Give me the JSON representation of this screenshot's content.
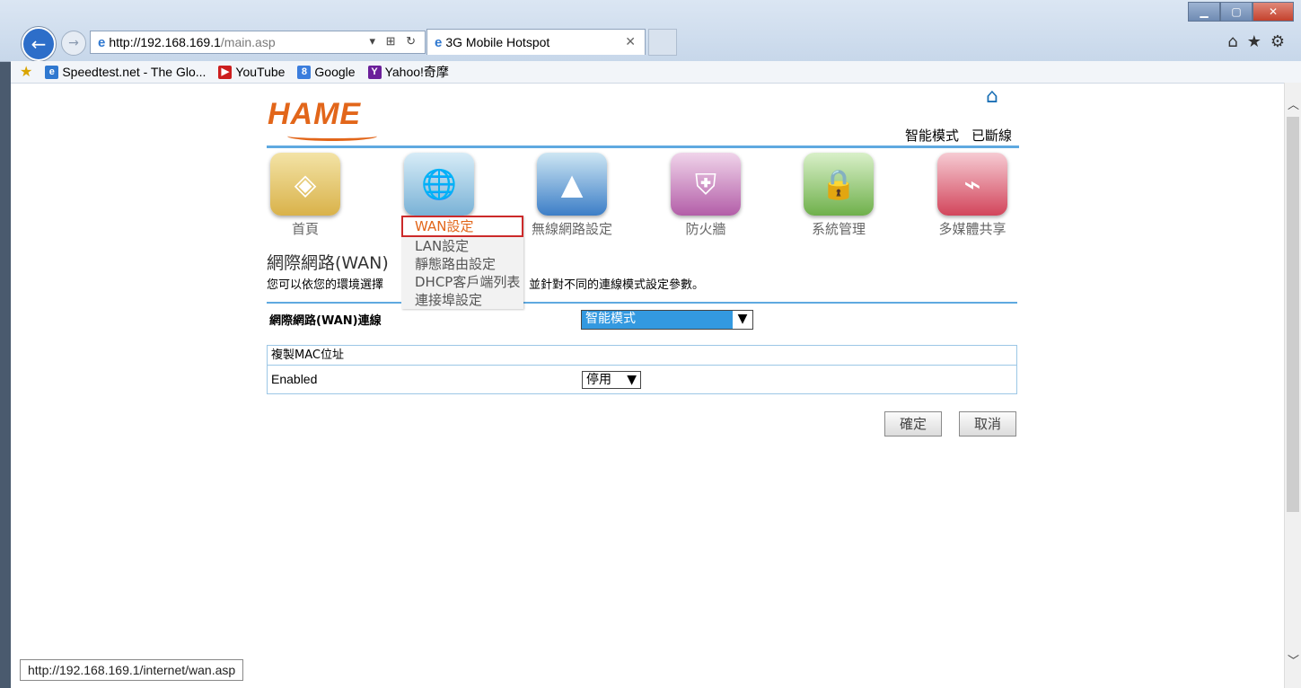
{
  "browser": {
    "url_host": "http://192.168.169.1",
    "url_path": "/main.asp",
    "tab_title": "3G Mobile Hotspot",
    "status_url": "http://192.168.169.1/internet/wan.asp"
  },
  "favorites": [
    {
      "label": "Speedtest.net - The Glo...",
      "icon": "ie-icon",
      "color": "#2f78d0"
    },
    {
      "label": "YouTube",
      "icon": "youtube-icon",
      "color": "#cc1e1e"
    },
    {
      "label": "Google",
      "icon": "google-icon",
      "color": "#3b7ddd"
    },
    {
      "label": "Yahoo!奇摩",
      "icon": "yahoo-icon",
      "color": "#6b1f9a"
    }
  ],
  "header": {
    "logo": "HAME",
    "mode": "智能模式",
    "connection": "已斷線"
  },
  "nav": [
    {
      "label": "首頁",
      "icon": "home-speaker-icon"
    },
    {
      "label": "",
      "icon": "globe-check-icon"
    },
    {
      "label": "無線網路設定",
      "icon": "wifi-tower-icon"
    },
    {
      "label": "防火牆",
      "icon": "shield-icon"
    },
    {
      "label": "系統管理",
      "icon": "lock-gear-icon"
    },
    {
      "label": "多媒體共享",
      "icon": "usb-wireless-icon"
    }
  ],
  "wan_menu": [
    "WAN設定",
    "LAN設定",
    "靜態路由設定",
    "DHCP客戶端列表",
    "連接埠設定"
  ],
  "section": {
    "title": "網際網路(WAN)",
    "desc_start": "您可以依您的環境選擇",
    "desc_end": "並針對不同的連線模式設定參數。",
    "conn_label": "網際網路(WAN)連線",
    "conn_value": "智能模式"
  },
  "mac": {
    "header": "複製MAC位址",
    "enabled_label": "Enabled",
    "enabled_value": "停用"
  },
  "buttons": {
    "ok": "確定",
    "cancel": "取消"
  }
}
